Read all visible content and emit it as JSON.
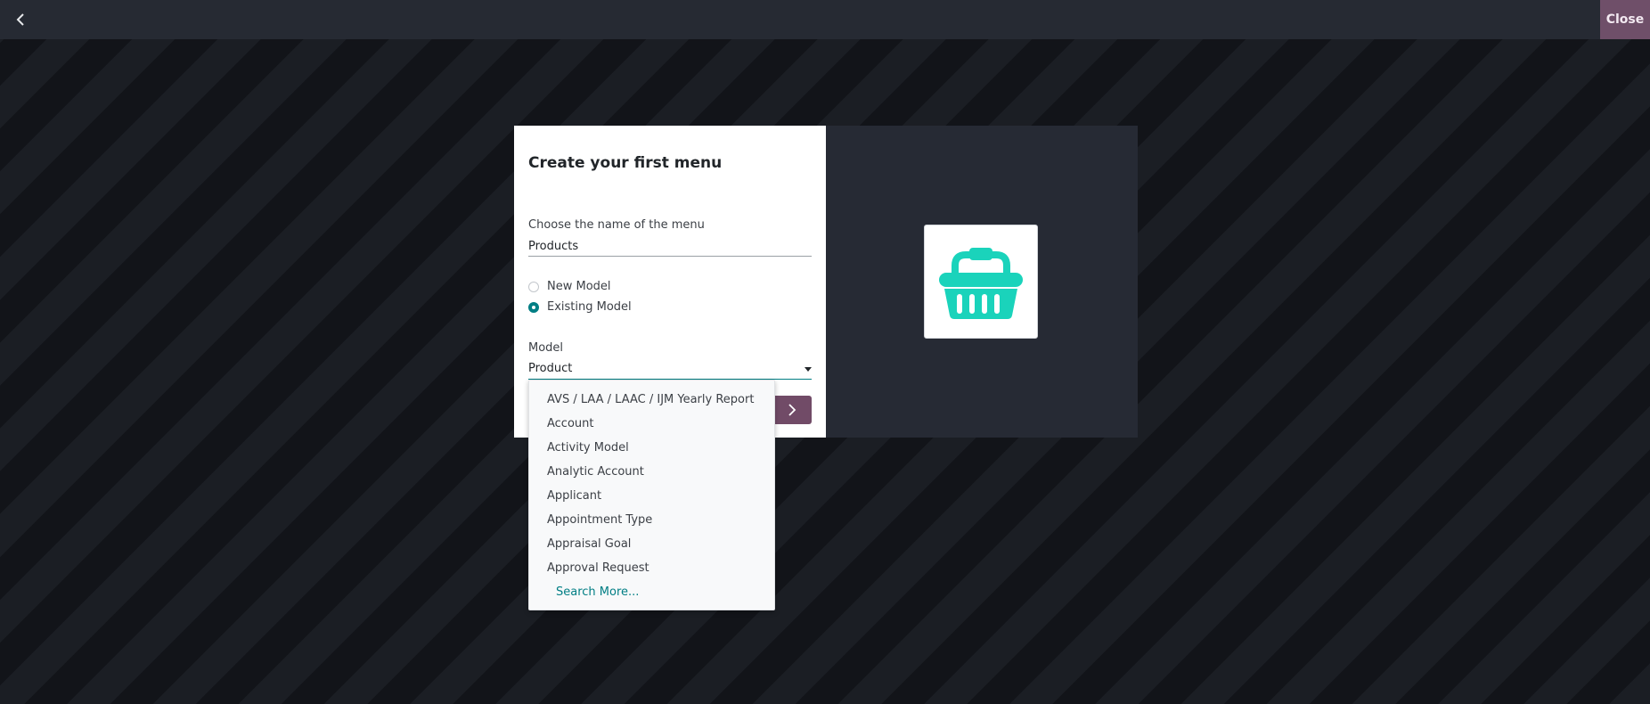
{
  "topbar": {
    "back_icon": "chevron-left-icon",
    "close_label": "Close"
  },
  "dialog": {
    "title": "Create your first menu",
    "menu_name": {
      "label": "Choose the name of the menu",
      "value": "Products"
    },
    "model_choice": {
      "options": [
        {
          "label": "New Model",
          "checked": false
        },
        {
          "label": "Existing Model",
          "checked": true
        }
      ]
    },
    "model": {
      "label": "Model",
      "value": "Product"
    },
    "next_icon": "chevron-right-icon",
    "preview_icon": "shopping-basket-icon",
    "colors": {
      "accent": "#017e84",
      "brand": "#714b67",
      "icon": "#1ad3bb"
    }
  },
  "dropdown": {
    "items": [
      "AVS / LAA / LAAC / IJM Yearly Report",
      "Account",
      "Activity Model",
      "Analytic Account",
      "Applicant",
      "Appointment Type",
      "Appraisal Goal",
      "Approval Request"
    ],
    "search_more": "Search More..."
  }
}
